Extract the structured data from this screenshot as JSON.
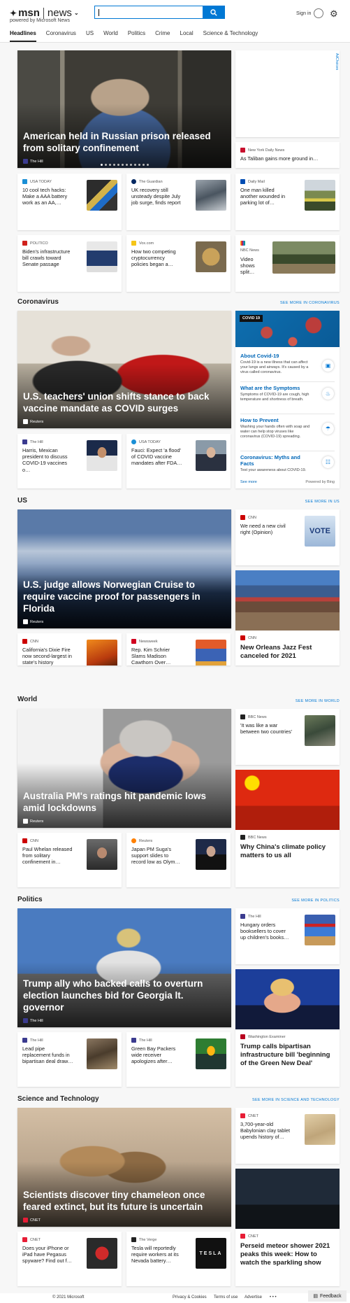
{
  "header": {
    "logo": "msn",
    "section": "news",
    "powered_by": "powered by Microsoft News",
    "signin": "Sign in"
  },
  "nav": [
    "Headlines",
    "Coronavirus",
    "US",
    "World",
    "Politics",
    "Crime",
    "Local",
    "Science & Technology"
  ],
  "adchoices": "AdChoices",
  "headlines": {
    "hero": {
      "title": "American held in Russian prison released from solitary confinement",
      "source": "The Hill"
    },
    "ny": {
      "source": "New York Daily News",
      "title": "As Taliban gains more ground in…"
    },
    "row1": [
      {
        "source": "USA TODAY",
        "title": "10 cool tech hacks: Make a AAA battery work as an AA,…"
      },
      {
        "source": "The Guardian",
        "title": "UK recovery still unsteady despite July job surge, finds report"
      },
      {
        "source": "Daily Mail",
        "title": "One man killed another wounded in parking lot of…"
      }
    ],
    "row2": [
      {
        "source": "POLITICO",
        "title": "Biden's infrastructure bill crawls toward Senate passage"
      },
      {
        "source": "Vox.com",
        "title": "How two competing cryptocurrency policies began a…"
      },
      {
        "source": "NBC News",
        "title": "Video shows split…"
      }
    ]
  },
  "coronavirus": {
    "heading": "Coronavirus",
    "more": "SEE MORE IN CORONAVIRUS",
    "hero": {
      "title": "U.S. teachers' union shifts stance to back vaccine mandate as COVID surges",
      "source": "Reuters"
    },
    "panel": {
      "badge": "COVID 19",
      "items": [
        {
          "title": "About Covid-19",
          "desc": "Covid-19 is a new illness that can affect your lungs and airways. It's caused by a virus called coronavirus."
        },
        {
          "title": "What are the Symptoms",
          "desc": "Symptoms of COVID-19 are cough, high temperature and shortness of breath."
        },
        {
          "title": "How to Prevent",
          "desc": "Washing your hands often with soap and water can help stop viruses like coronavirus (COVID-19) spreading."
        },
        {
          "title": "Coronavirus: Myths and Facts",
          "desc": "Test your awareness about COVID-19."
        }
      ],
      "see_more": "See more",
      "powered": "Powered by Bing"
    },
    "row": [
      {
        "source": "The Hill",
        "title": "Harris, Mexican president to discuss COVID-19 vaccines o…"
      },
      {
        "source": "USA TODAY",
        "title": "Fauci: Expect 'a flood' of COVID vaccine mandates after FDA…"
      }
    ]
  },
  "us": {
    "heading": "US",
    "more": "SEE MORE IN US",
    "side1": {
      "source": "CNN",
      "title": "We need a new civil right (Opinion)",
      "thumb_text": "VOTE"
    },
    "hero": {
      "title": "U.S. judge allows Norwegian Cruise to require vaccine proof for passengers in Florida",
      "source": "Reuters"
    },
    "tall": {
      "source": "CNN",
      "title": "New Orleans Jazz Fest canceled for 2021"
    },
    "row": [
      {
        "source": "CNN",
        "title": "California's Dixie Fire now second-largest in state's history"
      },
      {
        "source": "Newsweek",
        "title": "Rep. Kim Schrier Slams Madison Cawthorn Over…"
      }
    ]
  },
  "world": {
    "heading": "World",
    "more": "SEE MORE IN WORLD",
    "side1": {
      "source": "BBC News",
      "title": "'It was like a war between two countries'"
    },
    "hero": {
      "title": "Australia PM's ratings hit pandemic lows amid lockdowns",
      "source": "Reuters"
    },
    "tall": {
      "source": "BBC News",
      "title": "Why China's climate policy matters to us all"
    },
    "row": [
      {
        "source": "CNN",
        "title": "Paul Whelan released from solitary confinement in…"
      },
      {
        "source": "Reuters",
        "title": "Japan PM Suga's support slides to record low as Olym…"
      }
    ]
  },
  "politics": {
    "heading": "Politics",
    "more": "SEE MORE IN POLITICS",
    "side1": {
      "source": "The Hill",
      "title": "Hungary orders booksellers to cover up children's books…"
    },
    "hero": {
      "title": "Trump ally who backed calls to overturn election launches bid for Georgia lt. governor",
      "source": "The Hill"
    },
    "tall": {
      "source": "Washington Examiner",
      "title": "Trump calls bipartisan infrastructure bill 'beginning of the Green New Deal'"
    },
    "row": [
      {
        "source": "The Hill",
        "title": "Lead pipe replacement funds in bipartisan deal draw…"
      },
      {
        "source": "The Hill",
        "title": "Green Bay Packers wide receiver apologizes after…"
      }
    ]
  },
  "science": {
    "heading": "Science and Technology",
    "more": "SEE MORE IN SCIENCE AND TECHNOLOGY",
    "side1": {
      "source": "CNET",
      "title": "3,700-year-old Babylonian clay tablet upends history of…"
    },
    "hero": {
      "title": "Scientists discover tiny chameleon once feared extinct, but its future is uncertain",
      "source": "CNET"
    },
    "tall": {
      "source": "CNET",
      "title": "Perseid meteor shower 2021 peaks this week: How to watch the sparkling show"
    },
    "row": [
      {
        "source": "CNET",
        "title": "Does your iPhone or iPad have Pegasus spyware? Find out f…"
      },
      {
        "source": "The Verge",
        "title": "Tesla will reportedly require workers at its Nevada battery…",
        "thumb_text": "TESLA"
      }
    ]
  },
  "footer": {
    "copyright": "© 2021 Microsoft",
    "privacy": "Privacy & Cookies",
    "terms": "Terms of use",
    "advertise": "Advertise",
    "more": "• • •",
    "feedback": "Feedback"
  }
}
